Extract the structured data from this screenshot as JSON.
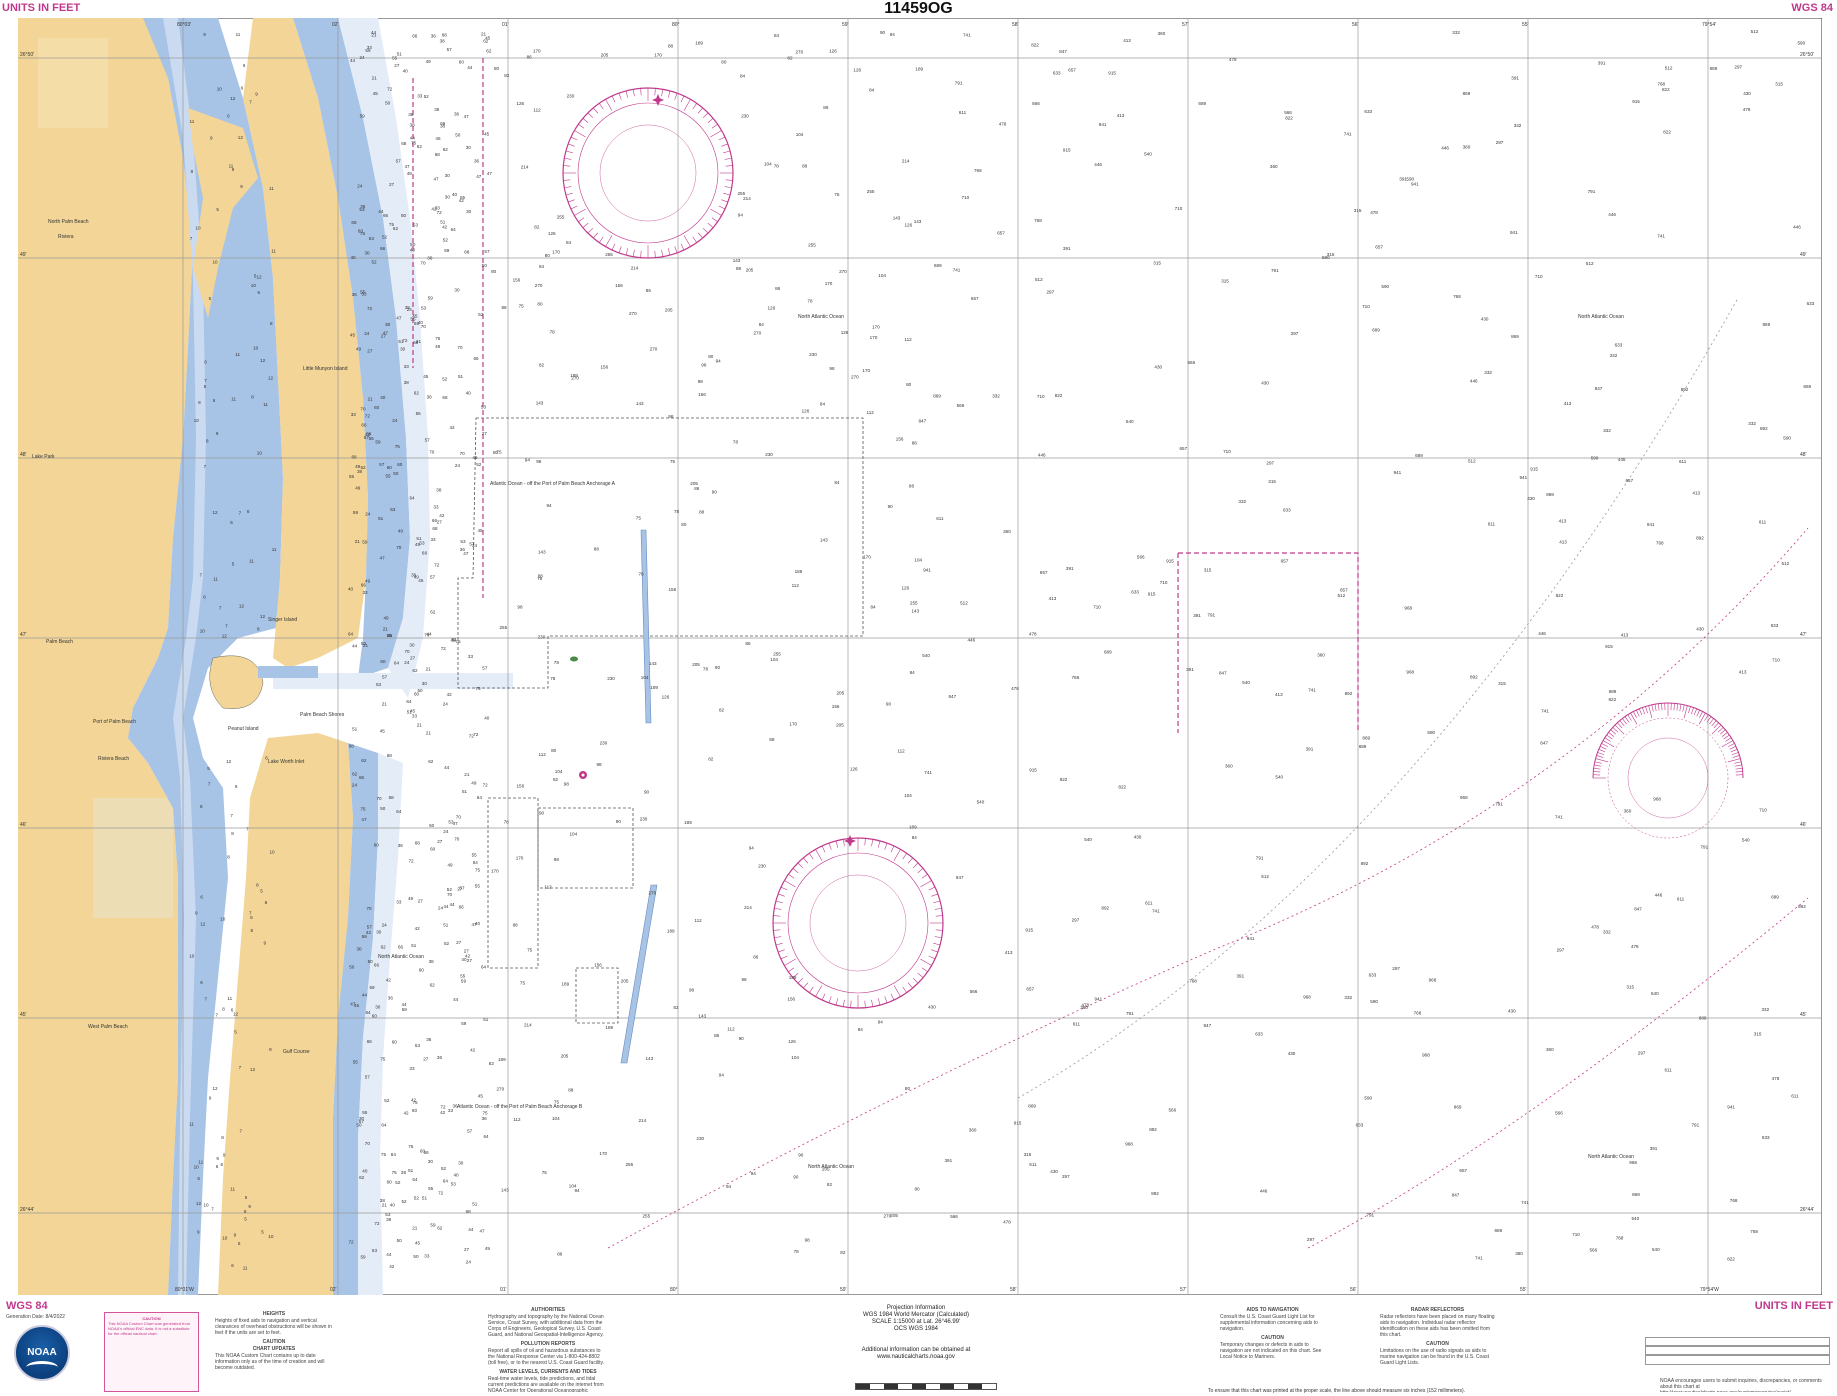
{
  "chart": {
    "number": "11459OG",
    "units_left": "UNITS IN FEET",
    "units_right": "UNITS IN FEET",
    "datum_right": "WGS 84",
    "datum_left": "WGS 84",
    "generation_date": "Generation Date: 8/4/2022"
  },
  "colors": {
    "land": "#f2d597",
    "shoal_blue": "#a7c3e6",
    "mid_blue": "#c9daf1",
    "light_blue": "#e4ecf8",
    "water": "#ffffff",
    "magenta": "#c0398c",
    "grid": "#9a9a9a",
    "urban": "#eadfbd"
  },
  "icons": [
    "compass-rose-icon",
    "noaa-logo-icon",
    "light-star-icon",
    "buoy-icon"
  ],
  "longitude_labels_top": [
    "80°03'",
    "02'",
    "01'",
    "80°",
    "59'",
    "58'",
    "57'",
    "56'",
    "55'",
    "79°54'"
  ],
  "longitude_labels_bottom": [
    "80°01'W",
    "02'",
    "01'",
    "80°",
    "59'",
    "58'",
    "57'",
    "56'",
    "55'",
    "79°54'W"
  ],
  "latitude_labels": [
    "26°50'",
    "49'",
    "48'",
    "47'",
    "46'",
    "45'",
    "26°44'"
  ],
  "place_labels": [
    "North Palm Beach",
    "Riviera",
    "Little Munyon Island",
    "Lake Park",
    "Palm Beach",
    "Port of Palm Beach",
    "Riviera Beach",
    "Peanut Island",
    "Palm Beach Shores",
    "Lake Worth Inlet",
    "West Palm Beach",
    "North Atlantic Ocean",
    "Singer Island",
    "Gulf Course"
  ],
  "anchorage_labels": [
    "Atlantic Ocean - off the Port of Palm Beach Anchorage A",
    "Atlantic Ocean - off the Port of Palm Beach Anchorage B"
  ],
  "soundings_left": [
    "21",
    "24",
    "27",
    "30",
    "33",
    "36",
    "38",
    "40",
    "42",
    "44",
    "45",
    "47",
    "49",
    "50",
    "51",
    "52",
    "53",
    "55",
    "57",
    "59",
    "60",
    "62",
    "64",
    "66",
    "68",
    "70",
    "72",
    "75"
  ],
  "soundings_middle": [
    "75",
    "78",
    "80",
    "82",
    "84",
    "86",
    "88",
    "90",
    "94",
    "98",
    "104",
    "112",
    "126",
    "143",
    "156",
    "170",
    "189",
    "205",
    "214",
    "230",
    "255",
    "270"
  ],
  "soundings_right": [
    "297",
    "315",
    "332",
    "360",
    "391",
    "413",
    "430",
    "446",
    "478",
    "512",
    "540",
    "566",
    "590",
    "611",
    "633",
    "657",
    "689",
    "710",
    "741",
    "768",
    "791",
    "822",
    "847",
    "869",
    "892",
    "915",
    "941",
    "968"
  ],
  "footer": {
    "caution_title": "CAUTION",
    "caution_text": "This NOAA Custom Chart was generated from NOAA's official ENC data. It is not a substitute for the official nautical chart.",
    "heights_title": "HEIGHTS",
    "heights_text": "Heights of fixed aids to navigation and vertical clearances of overhead obstructions will be shown in feet if the units are set to feet.",
    "updates_title": "CAUTION",
    "updates_subtitle": "CHART UPDATES",
    "updates_text": "This NOAA Custom Chart contains up to date information only as of the time of creation and will become outdated.",
    "authorities_title": "AUTHORITIES",
    "authorities_text": "Hydrography and topography by the National Ocean Service, Coast Survey, with additional data from the Corps of Engineers, Geological Survey, U.S. Coast Guard, and National Geospatial-Intelligence Agency.",
    "pollution_title": "POLLUTION REPORTS",
    "pollution_text": "Report all spills of oil and hazardous substances to the National Response Center via 1-800-424-8802 (toll free), or to the nearest U.S. Coast Guard facility.",
    "currents_title": "WATER LEVELS, CURRENTS AND TIDES",
    "currents_text": "Real-time water levels, tide predictions, and tidal current predictions are available on the internet from NOAA Center for Operational Oceanographic Products and Services (CO-OPS).",
    "projection_line1": "Projection Information",
    "projection_line2": "WGS 1984 World Mercator (Calculated)",
    "projection_line3": "SCALE 1:15000 at Lat. 26°46.99'",
    "projection_line4": "OCS WGS 1984",
    "additional_info": "Additional information can be obtained at www.nauticalcharts.noaa.gov",
    "aids_title": "AIDS TO NAVIGATION",
    "aids_text": "Consult the U.S. Coast Guard Light List for supplemental information concerning aids to navigation.",
    "aids_caution_title": "CAUTION",
    "aids_caution_text": "Temporary changes or defects in aids to navigation are not indicated on this chart. See Local Notice to Mariners.",
    "radar_title": "RADAR REFLECTORS",
    "radar_text": "Radar reflectors have been placed on many floating aids to navigation. Individual radar reflector identification on these aids has been omitted from this chart.",
    "radar_caution_title": "CAUTION",
    "radar_caution_text": "Limitations on the use of radio signals as aids to marine navigation can be found in the U.S. Coast Guard Light Lists.",
    "print_note": "To ensure that this chart was printed at the proper scale, the line above should measure six inches (152 millimeters).",
    "feedback_note": "NOAA encourages users to submit inquiries, discrepancies, or comments about this chart at http://www.nauticalcharts.noaa.gov/customerservice/assist/",
    "noaa_label": "NOAA"
  }
}
